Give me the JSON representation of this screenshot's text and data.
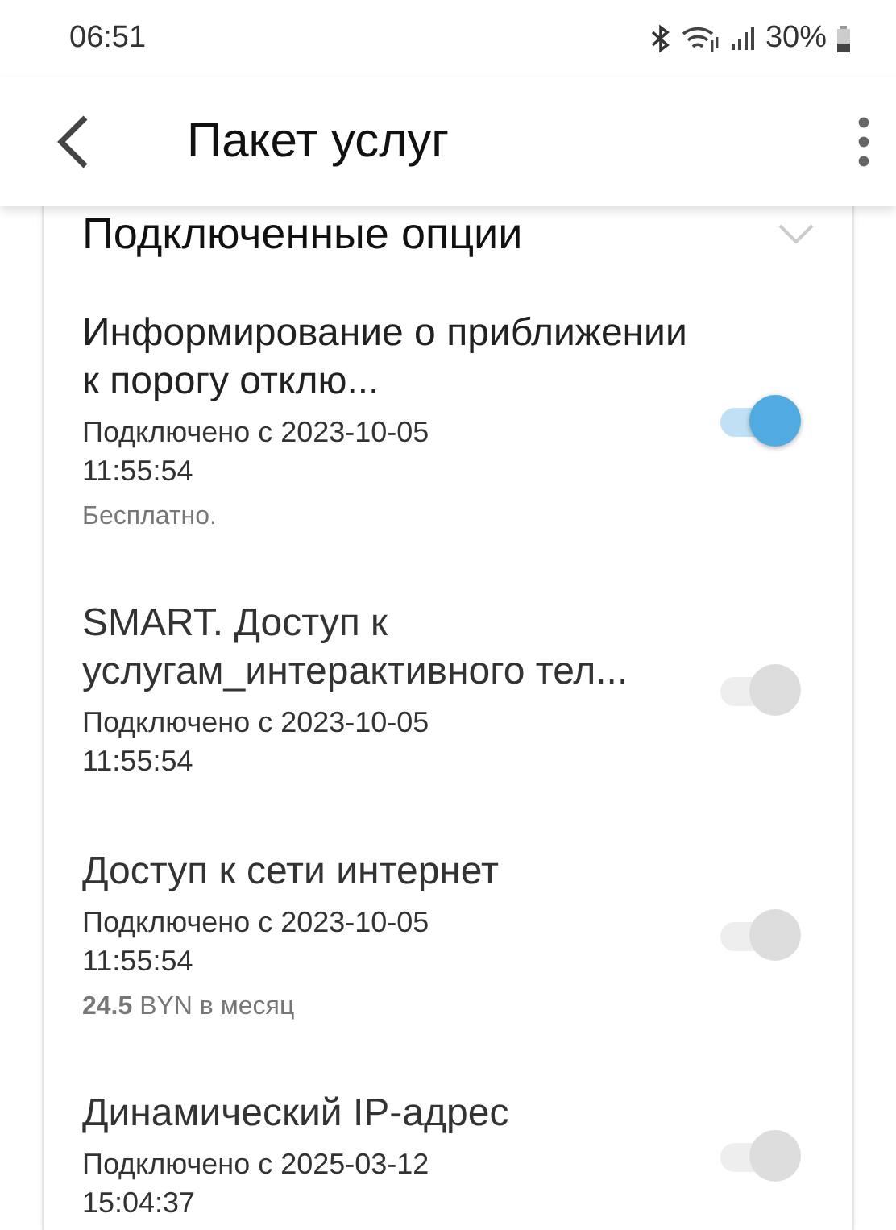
{
  "status_bar": {
    "time": "06:51",
    "battery": "30%"
  },
  "header": {
    "title": "Пакет услуг"
  },
  "section": {
    "title": "Подключенные опции",
    "expanded": true
  },
  "options": [
    {
      "title": "Информирование о приближении к порогу отклю...",
      "since": "Подключено с 2023-10-05 11:55:54",
      "note": "Бесплатно.",
      "on": true,
      "disabled": false
    },
    {
      "title": "SMART. Доступ к услугам_интерактивного тел...",
      "since": "Подключено с 2023-10-05 11:55:54",
      "on": true,
      "disabled": true
    },
    {
      "title": "Доступ к сети интернет",
      "since": "Подключено с 2023-10-05 11:55:54",
      "note": "**24.5** BYN в месяц",
      "on": true,
      "disabled": true
    },
    {
      "title": "Динамический IP-адрес",
      "since": "Подключено с 2025-03-12 15:04:37",
      "on": true,
      "disabled": true
    }
  ]
}
